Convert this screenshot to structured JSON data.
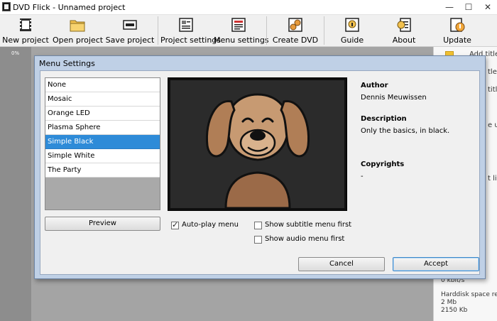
{
  "window": {
    "title": "DVD Flick - Unnamed project",
    "minimize": "—",
    "maximize": "☐",
    "close": "✕"
  },
  "toolbar": {
    "buttons": [
      {
        "label": "New project",
        "icon": "new-project-icon"
      },
      {
        "label": "Open project",
        "icon": "folder-icon"
      },
      {
        "label": "Save project",
        "icon": "save-icon"
      },
      {
        "label": "Project settings",
        "icon": "project-settings-icon"
      },
      {
        "label": "Menu settings",
        "icon": "menu-settings-icon"
      },
      {
        "label": "Create DVD",
        "icon": "create-dvd-icon"
      },
      {
        "label": "Guide",
        "icon": "guide-icon"
      },
      {
        "label": "About",
        "icon": "about-icon"
      },
      {
        "label": "Update",
        "icon": "update-icon"
      }
    ]
  },
  "main": {
    "progress_label": "0%"
  },
  "right_panel": {
    "add_title": "Add title...",
    "partial_lines": [
      "tle",
      "title",
      "e u",
      "t lis"
    ],
    "speed": "0 kbit/s",
    "harddisk_label": "Harddisk space required",
    "harddisk_mb": "2 Mb",
    "harddisk_kb": "2150 Kb"
  },
  "dialog": {
    "title": "Menu Settings",
    "menus": [
      "None",
      "Mosaic",
      "Orange LED",
      "Plasma Sphere",
      "Simple Black",
      "Simple White",
      "The Party"
    ],
    "selected_index": 4,
    "preview_button": "Preview",
    "author_label": "Author",
    "author_value": "Dennis Meuwissen",
    "description_label": "Description",
    "description_value": "Only the basics, in black.",
    "copyrights_label": "Copyrights",
    "copyrights_value": "-",
    "autoplay_label": "Auto-play menu",
    "autoplay_checked": true,
    "subtitle_first_label": "Show subtitle menu first",
    "subtitle_first_checked": false,
    "audio_first_label": "Show audio menu first",
    "audio_first_checked": false,
    "cancel_button": "Cancel",
    "accept_button": "Accept"
  },
  "colors": {
    "selection": "#2e8bd8",
    "dialog_frame": "#bfd0e6",
    "background_gray": "#a4a4a4"
  }
}
